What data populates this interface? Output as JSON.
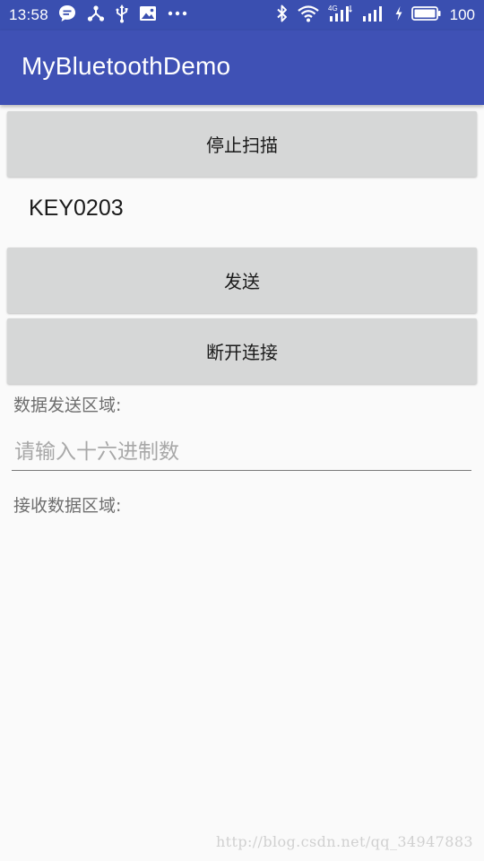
{
  "status_bar": {
    "time": "13:58",
    "battery_percent": "100",
    "left_icons": [
      "message-icon",
      "share-icon",
      "usb-icon",
      "image-icon",
      "more-dots-icon"
    ],
    "right_icons": [
      "bluetooth-icon",
      "wifi-icon",
      "signal-4g-icon",
      "signal-icon",
      "charging-icon",
      "battery-icon"
    ],
    "network_label": "4G"
  },
  "app_bar": {
    "title": "MyBluetoothDemo"
  },
  "buttons": {
    "stop_scan": "停止扫描",
    "send": "发送",
    "disconnect": "断开连接"
  },
  "device": {
    "name": "KEY0203"
  },
  "send_area": {
    "label": "数据发送区域:",
    "input_value": "",
    "input_placeholder": "请输入十六进制数"
  },
  "receive_area": {
    "label": "接收数据区域:"
  },
  "watermark": "http://blog.csdn.net/qq_34947883",
  "colors": {
    "status_bar": "#3a4fb0",
    "app_bar": "#3f51b5",
    "button_bg": "#d6d7d7",
    "page_bg": "#fafafa"
  }
}
